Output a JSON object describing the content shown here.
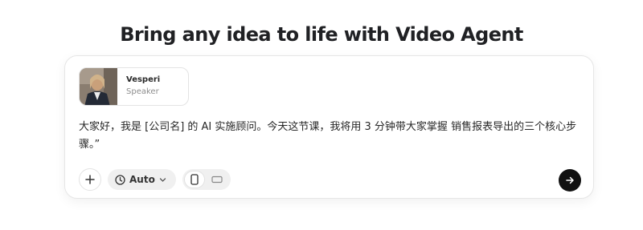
{
  "header": {
    "title": "Bring any idea to life with Video Agent"
  },
  "speaker": {
    "name": "Vesperi",
    "role": "Speaker"
  },
  "prompt": {
    "text": "大家好，我是 [公司名] 的 AI 实施顾问。今天这节课，我将用 3 分钟带大家掌握 销售报表导出的三个核心步骤。”"
  },
  "toolbar": {
    "add_icon": "plus-icon",
    "duration_icon": "clock-icon",
    "duration_value": "Auto",
    "dropdown_icon": "chevron-down-icon",
    "aspect_ratio_options": [
      "portrait",
      "landscape"
    ],
    "aspect_ratio_selected": "portrait",
    "send_icon": "arrow-right-icon"
  },
  "colors": {
    "send_button": "#111111",
    "pill_background": "#f0f0f0"
  }
}
